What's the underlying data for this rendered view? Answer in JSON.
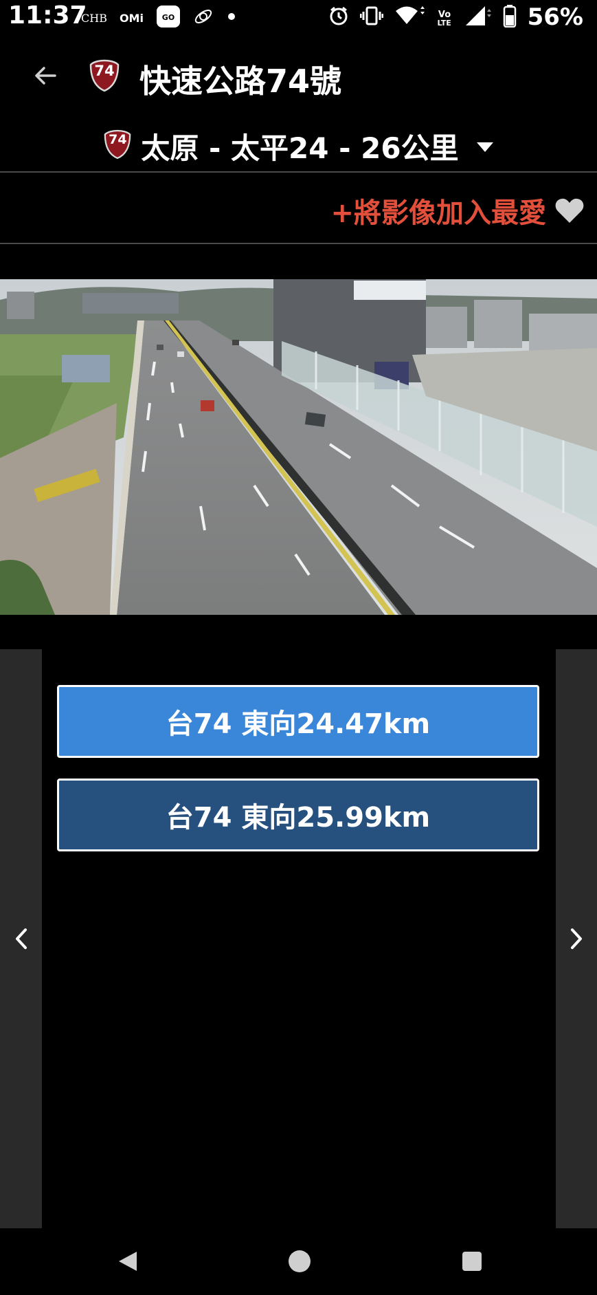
{
  "status_bar": {
    "time": "11:37",
    "carrier_labels": [
      "CHB",
      "OMi"
    ],
    "network_label": "LTE",
    "battery_percent": "56%",
    "icons": [
      "gogoro-app-icon",
      "satellite-icon",
      "notification-dot-icon",
      "alarm-icon",
      "vibrate-icon",
      "wifi-icon",
      "volte-icon",
      "signal-icon",
      "battery-icon"
    ]
  },
  "app_bar": {
    "route_badge": "74",
    "title": "快速公路74號"
  },
  "selector": {
    "route_badge": "74",
    "label": "太原 - 太平24 - 26公里"
  },
  "favorite": {
    "label": "+將影像加入最愛",
    "icon": "heart-icon"
  },
  "cameras": [
    {
      "label": "台74 東向24.47km",
      "color": "#3a86d8",
      "selected": true
    },
    {
      "label": "台74 東向25.99km",
      "color": "#26507e",
      "selected": false
    }
  ],
  "colors": {
    "background": "#000000",
    "accent_red": "#e2503c",
    "shield_red": "#8e1820",
    "panel_gray": "#2a2a2a"
  }
}
